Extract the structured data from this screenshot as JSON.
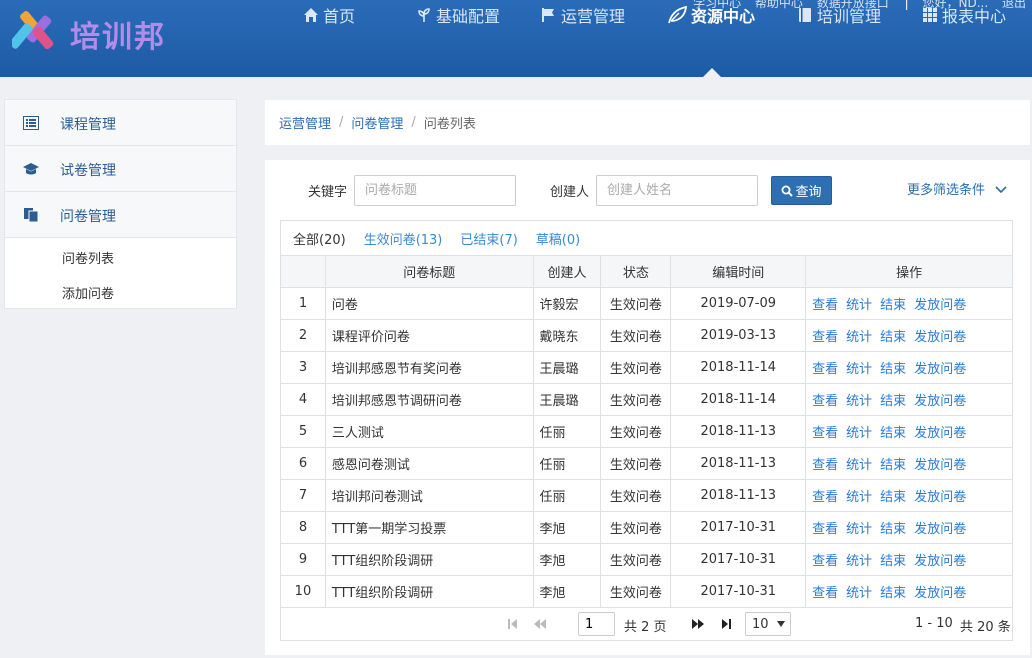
{
  "app": {
    "logo_text": "培训邦"
  },
  "toplinks": [
    "学习中心",
    "帮助中心",
    "数据开放接口",
    "|",
    "您好，ND...",
    "退出"
  ],
  "nav": [
    {
      "label": "首页",
      "icon": "home-icon"
    },
    {
      "label": "基础配置",
      "icon": "sprout-icon"
    },
    {
      "label": "运营管理",
      "icon": "flag-icon"
    },
    {
      "label": "资源中心",
      "icon": "leaf-icon",
      "active": true
    },
    {
      "label": "培训管理",
      "icon": "book-icon"
    },
    {
      "label": "报表中心",
      "icon": "grid-icon"
    }
  ],
  "sidebar": {
    "items": [
      {
        "label": "课程管理",
        "icon": "list-icon"
      },
      {
        "label": "试卷管理",
        "icon": "graduation-cap-icon"
      },
      {
        "label": "问卷管理",
        "icon": "documents-icon"
      }
    ],
    "sub_items": [
      "问卷列表",
      "添加问卷"
    ]
  },
  "breadcrumb": {
    "items": [
      "运营管理",
      "问卷管理"
    ],
    "current": "问卷列表"
  },
  "filter": {
    "keyword_label": "关键字",
    "keyword_placeholder": "问卷标题",
    "creator_label": "创建人",
    "creator_placeholder": "创建人姓名",
    "query_button": "查询",
    "more_filters": "更多筛选条件"
  },
  "tabs": [
    {
      "label": "全部(20)",
      "active": true
    },
    {
      "label": "生效问卷(13)"
    },
    {
      "label": "已结束(7)"
    },
    {
      "label": "草稿(0)"
    }
  ],
  "table": {
    "headers": [
      "",
      "问卷标题",
      "创建人",
      "状态",
      "编辑时间",
      "操作"
    ],
    "actions": [
      "查看",
      "统计",
      "结束",
      "发放问卷"
    ],
    "rows": [
      {
        "no": "1",
        "title": "问卷",
        "creator": "许毅宏",
        "status": "生效问卷",
        "time": "2019-07-09"
      },
      {
        "no": "2",
        "title": "课程评价问卷",
        "creator": "戴晓东",
        "status": "生效问卷",
        "time": "2019-03-13"
      },
      {
        "no": "3",
        "title": "培训邦感恩节有奖问卷",
        "creator": "王晨璐",
        "status": "生效问卷",
        "time": "2018-11-14"
      },
      {
        "no": "4",
        "title": "培训邦感恩节调研问卷",
        "creator": "王晨璐",
        "status": "生效问卷",
        "time": "2018-11-14"
      },
      {
        "no": "5",
        "title": "三人测试",
        "creator": "任丽",
        "status": "生效问卷",
        "time": "2018-11-13"
      },
      {
        "no": "6",
        "title": "感恩问卷测试",
        "creator": "任丽",
        "status": "生效问卷",
        "time": "2018-11-13"
      },
      {
        "no": "7",
        "title": "培训邦问卷测试",
        "creator": "任丽",
        "status": "生效问卷",
        "time": "2018-11-13"
      },
      {
        "no": "8",
        "title": "TTT第一期学习投票",
        "creator": "李旭",
        "status": "生效问卷",
        "time": "2017-10-31"
      },
      {
        "no": "9",
        "title": "TTT组织阶段调研",
        "creator": "李旭",
        "status": "生效问卷",
        "time": "2017-10-31"
      },
      {
        "no": "10",
        "title": "TTT组织阶段调研",
        "creator": "李旭",
        "status": "生效问卷",
        "time": "2017-10-31"
      }
    ]
  },
  "pager": {
    "current_page": "1",
    "total_pages": "共 2 页",
    "page_size": "10",
    "range": "1 - 10",
    "total": "共 20 条"
  },
  "colors": {
    "header_blue": "#1e5aa6",
    "link_blue": "#2b7bd0",
    "button_blue": "#2e6fb4",
    "logo_purple": "#b48ce8"
  }
}
